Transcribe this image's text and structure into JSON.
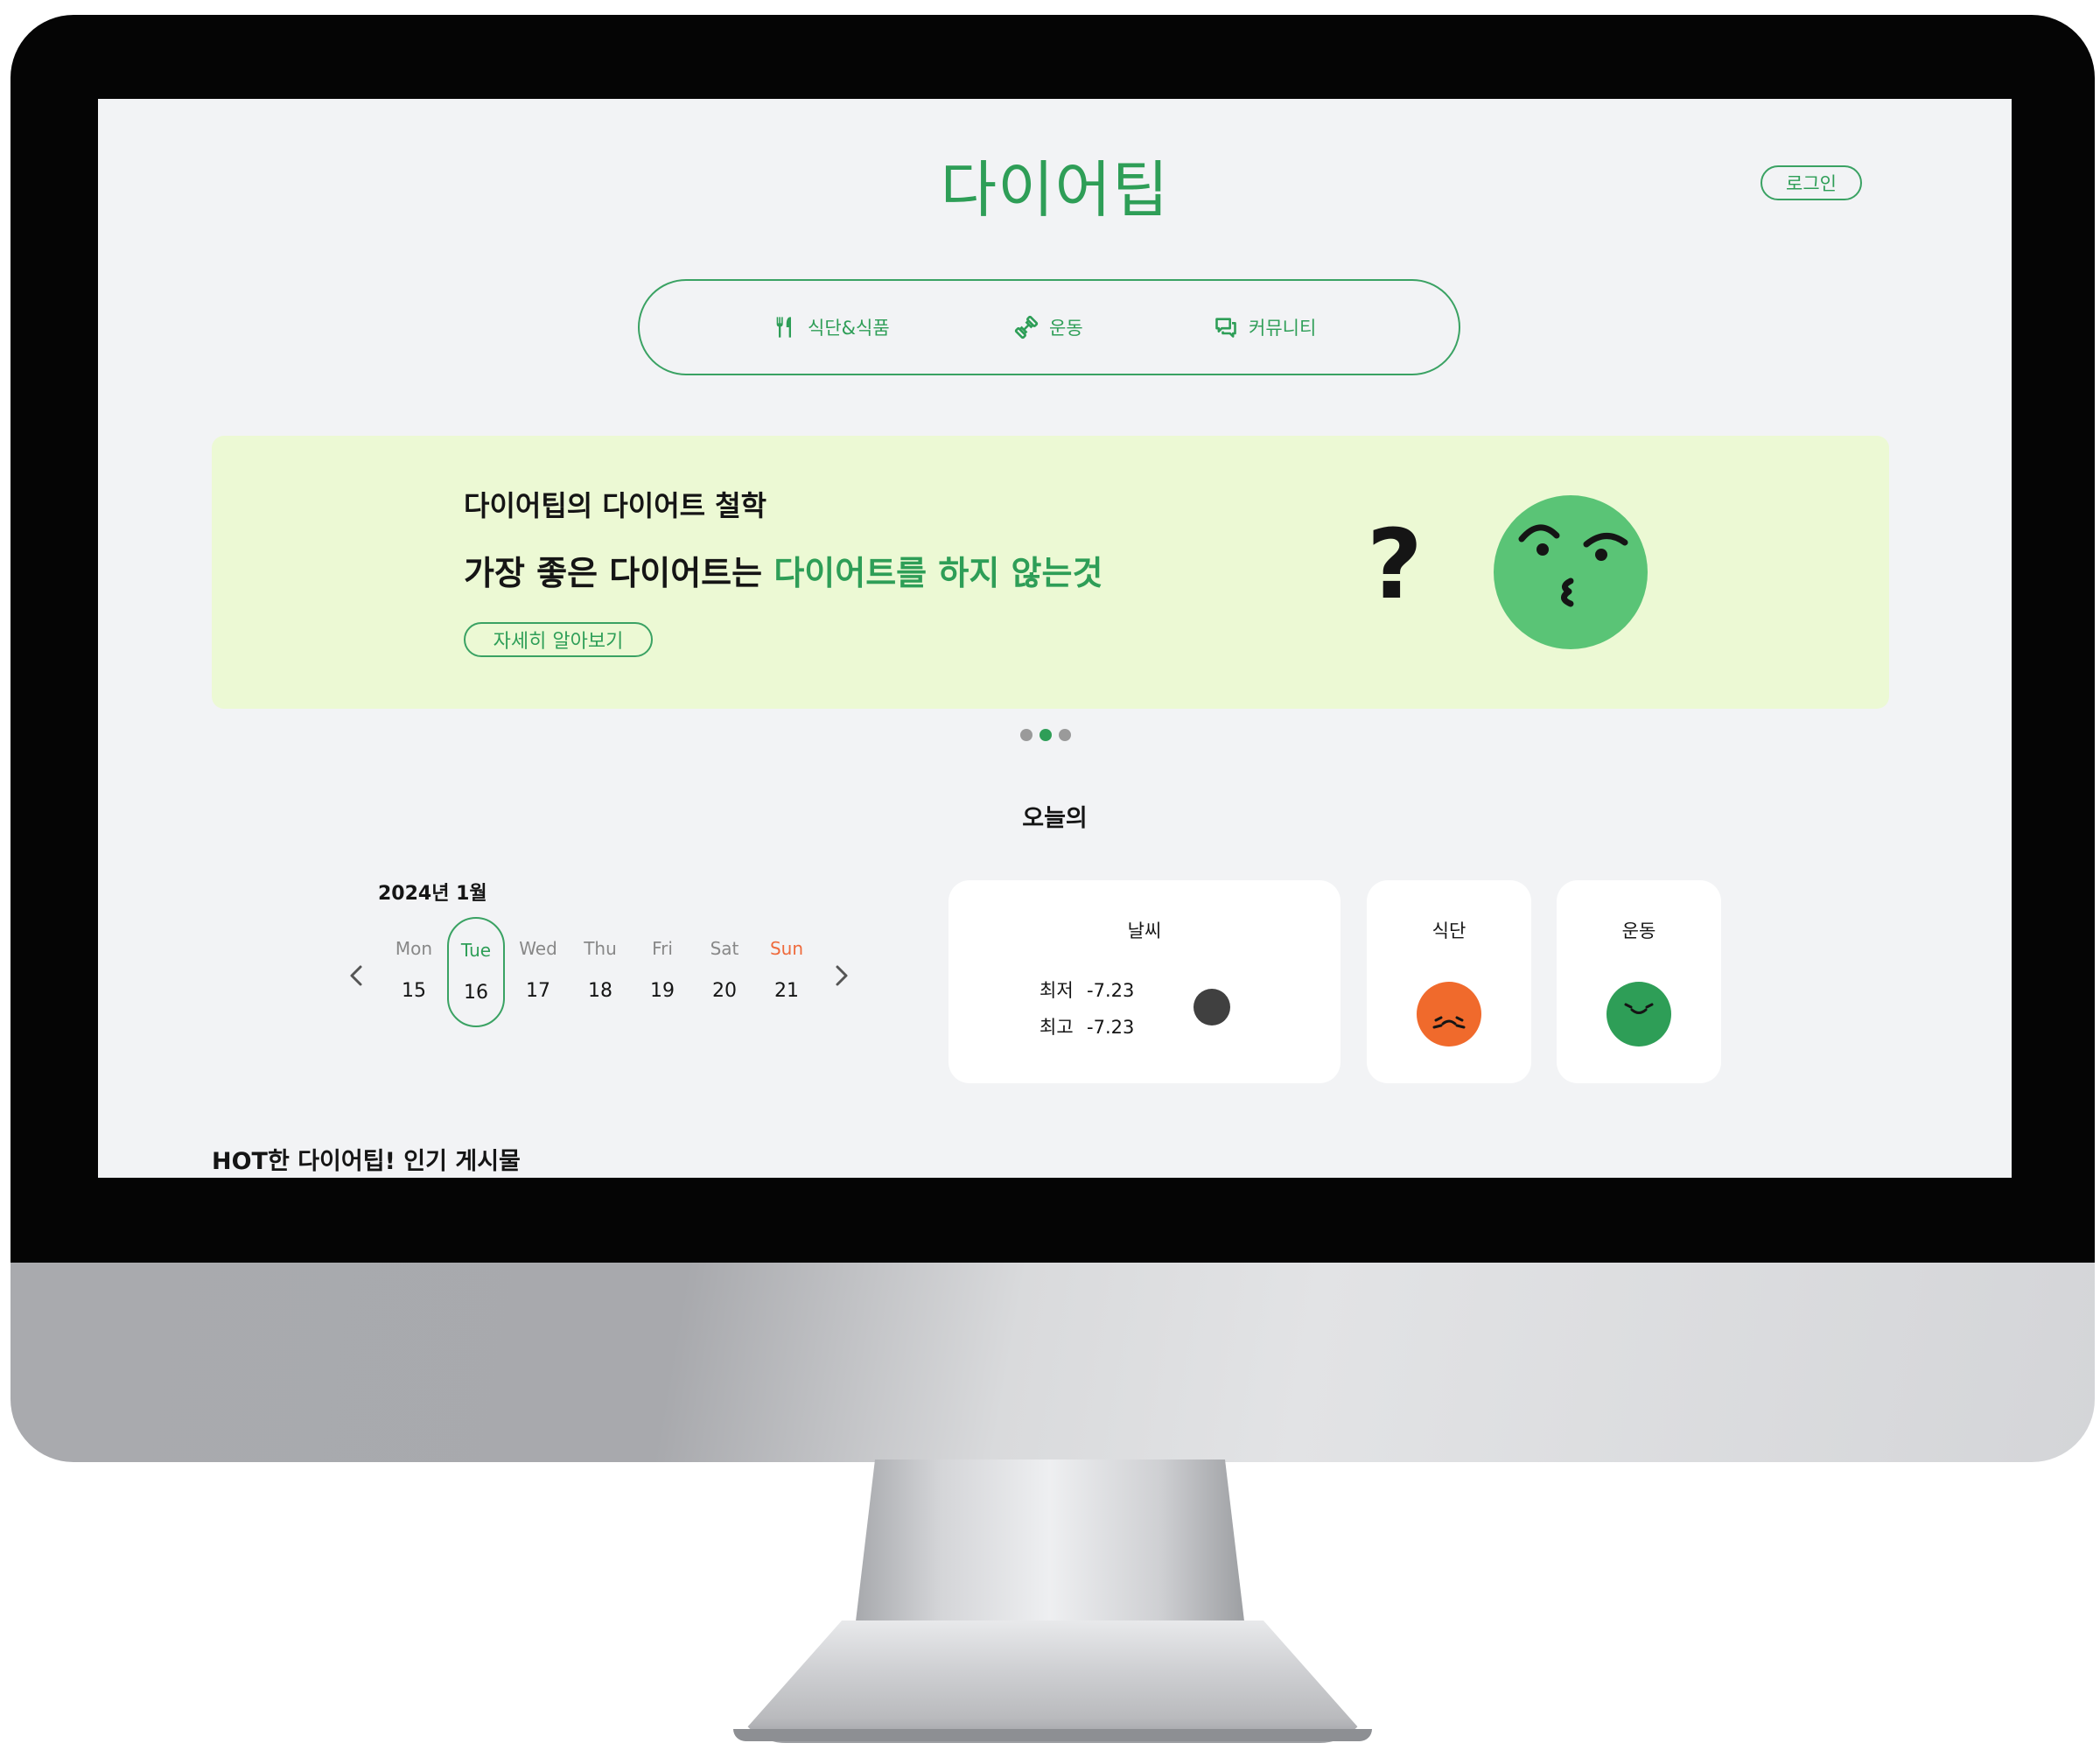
{
  "app": {
    "logo": "다이어팁",
    "login_label": "로그인"
  },
  "nav": {
    "items": [
      {
        "label": "식단&식품",
        "icon": "fork-knife-icon"
      },
      {
        "label": "운동",
        "icon": "dumbbell-icon"
      },
      {
        "label": "커뮤니티",
        "icon": "chat-icon"
      }
    ]
  },
  "banner": {
    "subtitle": "다이어팁의 다이어트 철학",
    "title_plain": "가장 좋은 다이어트는 ",
    "title_highlight": "다이어트를 하지 않는것",
    "more_label": "자세히 알아보기",
    "mark": "?",
    "slides_total": 3,
    "active_slide": 2
  },
  "today": {
    "title": "오늘의",
    "calendar": {
      "month_label": "2024년  1월",
      "days": [
        {
          "name": "Mon",
          "date": "15"
        },
        {
          "name": "Tue",
          "date": "16",
          "selected": true
        },
        {
          "name": "Wed",
          "date": "17"
        },
        {
          "name": "Thu",
          "date": "18"
        },
        {
          "name": "Fri",
          "date": "19"
        },
        {
          "name": "Sat",
          "date": "20"
        },
        {
          "name": "Sun",
          "date": "21",
          "sunday": true
        }
      ]
    },
    "weather": {
      "title": "날씨",
      "min_label": "최저",
      "min_value": "-7.23",
      "max_label": "최고",
      "max_value": "-7.23"
    },
    "diet": {
      "title": "식단",
      "color": "#f06a2c"
    },
    "exercise": {
      "title": "운동",
      "color": "#2e9e57"
    }
  },
  "hot": {
    "title": "HOT한 다이어팁! 인기 게시물"
  },
  "colors": {
    "brand_green": "#2e9e57",
    "banner_bg": "#ecf9d4",
    "screen_bg": "#f2f3f5",
    "sunday": "#ef6a3c"
  }
}
